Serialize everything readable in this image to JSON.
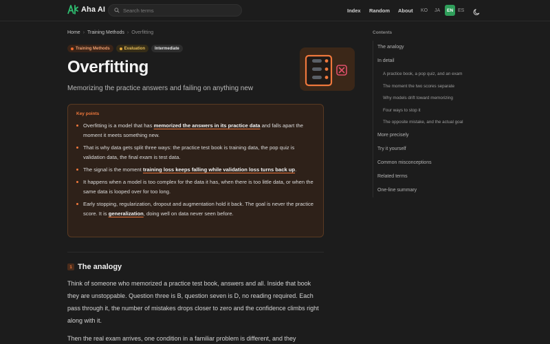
{
  "header": {
    "logo_text": "Aha AI",
    "search_placeholder": "Search terms",
    "nav": [
      "Index",
      "Random",
      "About"
    ],
    "languages": [
      "KO",
      "JA",
      "EN",
      "ES"
    ],
    "active_language": "EN"
  },
  "breadcrumb": [
    "Home",
    "Training Methods",
    "Overfitting"
  ],
  "tags": [
    "Training Methods",
    "Evaluation",
    "Intermediate"
  ],
  "page": {
    "title": "Overfitting",
    "subtitle": "Memorizing the practice answers and failing on anything new"
  },
  "key_points": {
    "title": "Key points",
    "items": [
      {
        "pre": "Overfitting is a model that has ",
        "hl": "memorized the answers in its practice data",
        "post": " and falls apart the moment it meets something new."
      },
      {
        "pre": "That is why data gets split three ways: the practice test book is training data, the pop quiz is validation data, the final exam is test data.",
        "hl": "",
        "post": ""
      },
      {
        "pre": "The signal is the moment ",
        "hl": "training loss keeps falling while validation loss turns back up",
        "post": "."
      },
      {
        "pre": "It happens when a model is too complex for the data it has, when there is too little data, or when the same data is looped over for too long.",
        "hl": "",
        "post": ""
      },
      {
        "pre": "Early stopping, regularization, dropout and augmentation hold it back. The goal is never the practice score. It is ",
        "hl": "generalization",
        "post": ", doing well on data never seen before."
      }
    ]
  },
  "section": {
    "number": "1",
    "title": "The analogy",
    "para1": "Think of someone who memorized a practice test book, answers and all. Inside that book they are unstoppable. Question three is B, question seven is D, no reading required. Each pass through it, the number of mistakes drops closer to zero and the confidence climbs right along with it.",
    "para2": "Then the real exam arrives, one condition in a familiar problem is different, and they"
  },
  "toc": {
    "title": "Contents",
    "items": [
      {
        "label": "The analogy",
        "level": 1
      },
      {
        "label": "In detail",
        "level": 1
      },
      {
        "label": "A practice book, a pop quiz, and an exam",
        "level": 2
      },
      {
        "label": "The moment the two scores separate",
        "level": 2
      },
      {
        "label": "Why models drift toward memorizing",
        "level": 2
      },
      {
        "label": "Four ways to stop it",
        "level": 2
      },
      {
        "label": "The opposite mistake, and the actual goal",
        "level": 2
      },
      {
        "label": "More precisely",
        "level": 1
      },
      {
        "label": "Try it yourself",
        "level": 1
      },
      {
        "label": "Common misconceptions",
        "level": 1
      },
      {
        "label": "Related terms",
        "level": 1
      },
      {
        "label": "One-line summary",
        "level": 1
      }
    ]
  },
  "colors": {
    "accent": "#f0783c",
    "active_language_bg": "#2f9e5a",
    "background": "#1c1c1c"
  },
  "icons": [
    "logo-icon",
    "search-icon",
    "moon-icon",
    "checklist-reject-icon"
  ]
}
